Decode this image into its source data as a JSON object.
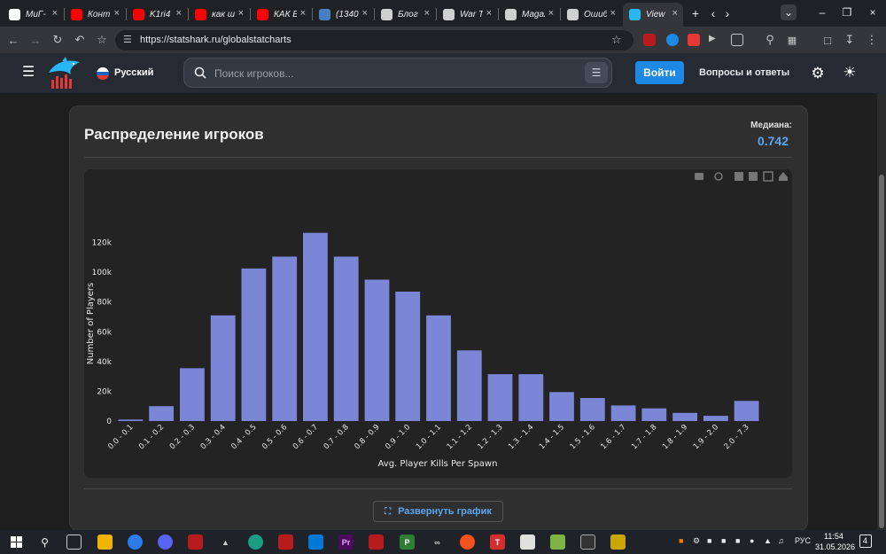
{
  "browser": {
    "tabs": [
      {
        "title": "МиГ-",
        "icon": "google-icon",
        "color": "#ffffff"
      },
      {
        "title": "Конт",
        "icon": "youtube-icon",
        "color": "#ff0000"
      },
      {
        "title": "K1ri4",
        "icon": "youtube-icon",
        "color": "#ff0000"
      },
      {
        "title": "как ш",
        "icon": "youtube-icon",
        "color": "#ff0000"
      },
      {
        "title": "КАК Б",
        "icon": "youtube-icon",
        "color": "#ff0000"
      },
      {
        "title": "(1340",
        "icon": "vk-icon",
        "color": "#4680c2"
      },
      {
        "title": "Блог",
        "icon": "diamond-icon",
        "color": "#d0d0d0"
      },
      {
        "title": "War T",
        "icon": "war-thunder-icon",
        "color": "#d0d0d0"
      },
      {
        "title": "Magaz",
        "icon": "gaijin-icon",
        "color": "#d0d0d0"
      },
      {
        "title": "Ошиб",
        "icon": "gear-icon",
        "color": "#d0d0d0"
      },
      {
        "title": "View",
        "icon": "statshark-icon",
        "color": "#29b6f6",
        "active": true
      }
    ],
    "url": "https://statshark.ru/globalstatcharts",
    "new_tab_symbol": "+"
  },
  "site": {
    "language": "Русский",
    "search_placeholder": "Поиск игроков...",
    "login_label": "Войти",
    "faq_label": "Вопросы и ответы"
  },
  "card": {
    "title": "Распределение игроков",
    "median_label": "Медиана:",
    "median_value": "0.742",
    "expand_label": "Развернуть график"
  },
  "chart_data": {
    "type": "bar",
    "xlabel": "Avg. Player Kills Per Spawn",
    "ylabel": "Number of Players",
    "categories": [
      "0.0 - 0.1",
      "0.1 - 0.2",
      "0.2 - 0.3",
      "0.3 - 0.4",
      "0.4 - 0.5",
      "0.5 - 0.6",
      "0.6 - 0.7",
      "0.7 - 0.8",
      "0.8 - 0.9",
      "0.9 - 1.0",
      "1.0 - 1.1",
      "1.1 - 1.2",
      "1.2 - 1.3",
      "1.3 - 1.4",
      "1.4 - 1.5",
      "1.5 - 1.6",
      "1.6 - 1.7",
      "1.7 - 1.8",
      "1.8 - 1.9",
      "1.9 - 2.0",
      "2.0 - 7.3"
    ],
    "values": [
      1000,
      10000,
      35500,
      71000,
      102500,
      110500,
      126500,
      110500,
      95000,
      87000,
      71000,
      47500,
      31500,
      31500,
      19500,
      15500,
      10500,
      8500,
      5500,
      3500,
      13500
    ],
    "ylim": [
      0,
      140000
    ],
    "yticks": [
      0,
      20000,
      40000,
      60000,
      80000,
      100000,
      120000
    ],
    "ytick_labels": [
      "0",
      "20k",
      "40k",
      "60k",
      "80k",
      "100k",
      "120k"
    ],
    "bar_color": "#7b86d6",
    "grid": false
  },
  "taskbar": {
    "language": "РУС",
    "time": "11:54",
    "date": "31.05.2026",
    "notifications": "4"
  }
}
